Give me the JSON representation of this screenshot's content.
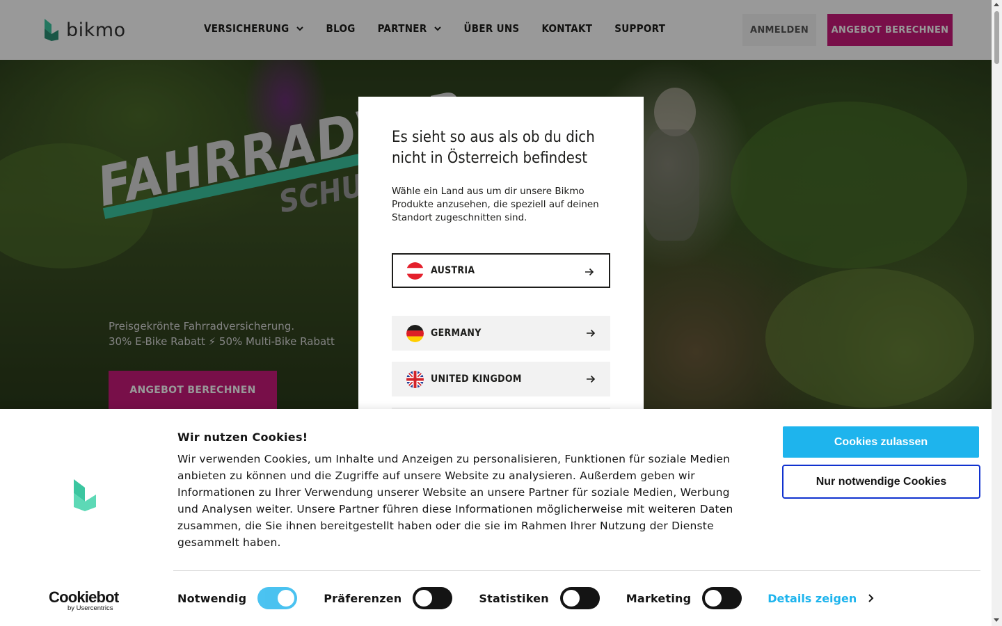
{
  "header": {
    "logo_text": "bikmo",
    "nav": [
      {
        "label": "VERSICHERUNG",
        "has_dropdown": true
      },
      {
        "label": "BLOG",
        "has_dropdown": false
      },
      {
        "label": "PARTNER",
        "has_dropdown": true
      },
      {
        "label": "ÜBER UNS",
        "has_dropdown": false
      },
      {
        "label": "KONTAKT",
        "has_dropdown": false
      },
      {
        "label": "SUPPORT",
        "has_dropdown": false
      }
    ],
    "login_label": "ANMELDEN",
    "quote_label": "ANGEBOT BERECHNEN"
  },
  "hero": {
    "title": "FAHRRADVER",
    "subtitle": "SCHUTZ",
    "text_line1": "Preisgekrönte Fahrradversicherung.",
    "text_line2": "30% E-Bike Rabatt ⚡ 50% Multi-Bike Rabatt",
    "cta_label": "ANGEBOT BERECHNEN"
  },
  "country_modal": {
    "title": "Es sieht so aus als ob du dich nicht in Österreich befindest",
    "description": "Wähle ein Land aus um dir unsere Bikmo Produkte anzusehen, die speziell auf deinen Standort zugeschnitten sind.",
    "countries": [
      {
        "label": "AUSTRIA",
        "flag": "austria-flag",
        "selected": true
      },
      {
        "label": "GERMANY",
        "flag": "germany-flag",
        "selected": false
      },
      {
        "label": "UNITED KINGDOM",
        "flag": "uk-flag",
        "selected": false
      }
    ]
  },
  "cookie_banner": {
    "title": "Wir nutzen Cookies!",
    "text": "Wir verwenden Cookies, um Inhalte und Anzeigen zu personalisieren, Funktionen für soziale Medien anbieten zu können und die Zugriffe auf unsere Website zu analysieren. Außerdem geben wir Informationen zu Ihrer Verwendung unserer Website an unsere Partner für soziale Medien, Werbung und Analysen weiter. Unsere Partner führen diese Informationen möglicherweise mit weiteren Daten zusammen, die Sie ihnen bereitgestellt haben oder die sie im Rahmen Ihrer Nutzung der Dienste gesammelt haben.",
    "allow_label": "Cookies zulassen",
    "necessary_label": "Nur notwendige Cookies",
    "toggles": [
      {
        "label": "Notwendig",
        "on": true
      },
      {
        "label": "Präferenzen",
        "on": false
      },
      {
        "label": "Statistiken",
        "on": false
      },
      {
        "label": "Marketing",
        "on": false
      }
    ],
    "details_label": "Details zeigen",
    "cookiebot_brand": "Cookiebot",
    "cookiebot_sub": "by Usercentrics"
  },
  "colors": {
    "brand_pink": "#c81a7a",
    "brand_teal": "#3bc6a0",
    "cookie_blue": "#1eb4ed",
    "focus_blue": "#1032cf"
  }
}
